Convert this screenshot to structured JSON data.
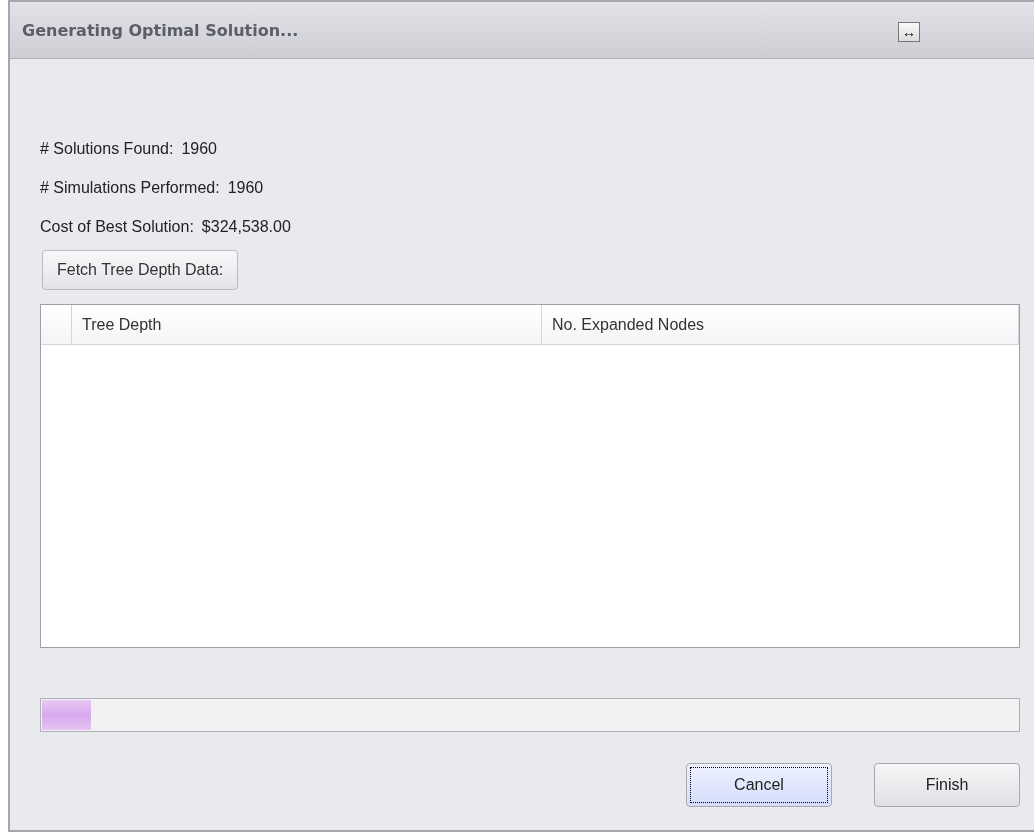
{
  "window": {
    "title": "Generating Optimal Solution...",
    "title_button": "↔"
  },
  "stats": [
    {
      "label": "# Solutions Found:",
      "value": "1960"
    },
    {
      "label": "# Simulations Performed:",
      "value": "1960"
    },
    {
      "label": "Cost of Best Solution:",
      "value": "$324,538.00"
    }
  ],
  "fetch_button": "Fetch Tree Depth Data:",
  "table": {
    "columns": [
      "Tree Depth",
      "No. Expanded Nodes"
    ]
  },
  "progress": {
    "level": 0.05
  },
  "buttons": [
    {
      "label": "Cancel",
      "focused": true
    },
    {
      "label": "Finish",
      "focused": false
    }
  ]
}
